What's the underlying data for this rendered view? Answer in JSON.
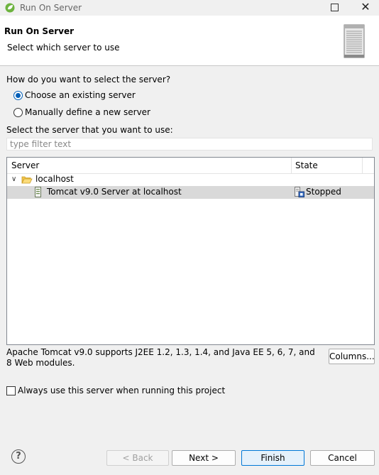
{
  "window": {
    "title": "Run On Server"
  },
  "header": {
    "title": "Run On Server",
    "subtitle": "Select which server to use"
  },
  "selection_method": {
    "question": "How do you want to select the server?",
    "options": [
      {
        "label": "Choose an existing server",
        "selected": true
      },
      {
        "label": "Manually define a new server",
        "selected": false
      }
    ]
  },
  "server_list": {
    "label": "Select the server that you want to use:",
    "filter_placeholder": "type filter text",
    "columns": [
      "Server",
      "State"
    ],
    "groups": [
      {
        "name": "localhost",
        "expanded": true,
        "servers": [
          {
            "name": "Tomcat v9.0 Server at localhost",
            "state": "Stopped",
            "selected": true
          }
        ]
      }
    ]
  },
  "description": "Apache Tomcat v9.0 supports J2EE 1.2, 1.3, 1.4, and Java EE 5, 6, 7, and 8 Web modules.",
  "columns_button": "Columns...",
  "always_use": {
    "label": "Always use this server when running this project",
    "checked": false
  },
  "buttons": {
    "back": "< Back",
    "next": "Next >",
    "finish": "Finish",
    "cancel": "Cancel"
  },
  "colors": {
    "accent": "#005fb8",
    "selection": "#d9d9d9",
    "default_button_border": "#0078d7"
  }
}
